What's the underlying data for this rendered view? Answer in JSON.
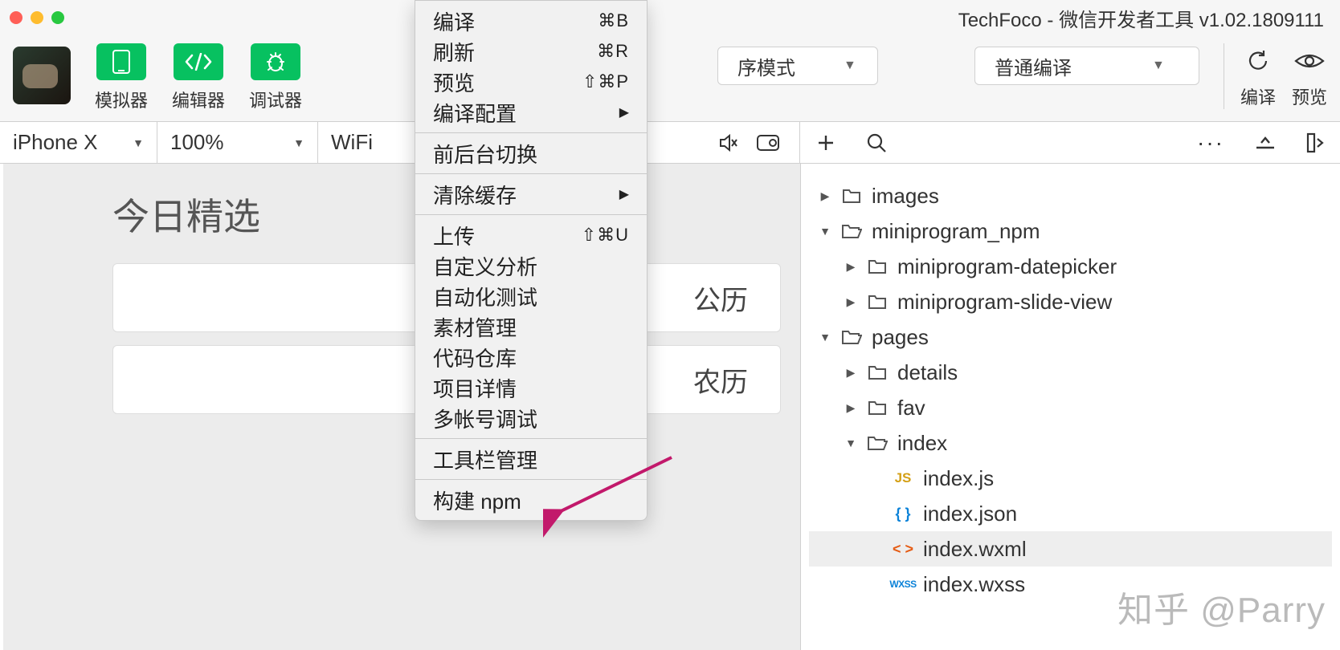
{
  "window": {
    "title": "TechFoco - 微信开发者工具 v1.02.1809111"
  },
  "toolbar": {
    "simulator": "模拟器",
    "editor": "编辑器",
    "debugger": "调试器",
    "mode_suffix": "序模式",
    "compile_mode": "普通编译",
    "compile": "编译",
    "preview": "预览"
  },
  "subbar": {
    "device": "iPhone X",
    "zoom": "100%",
    "network": "WiFi"
  },
  "simulator": {
    "heading": "今日精选",
    "row1": "公历",
    "row2": "农历"
  },
  "menu": {
    "items": [
      {
        "label": "编译",
        "shortcut": "⌘B",
        "type": "item"
      },
      {
        "label": "刷新",
        "shortcut": "⌘R",
        "type": "item"
      },
      {
        "label": "预览",
        "shortcut": "⇧⌘P",
        "type": "item"
      },
      {
        "label": "编译配置",
        "shortcut": "",
        "type": "submenu"
      },
      {
        "type": "sep"
      },
      {
        "label": "前后台切换",
        "shortcut": "",
        "type": "item"
      },
      {
        "type": "sep"
      },
      {
        "label": "清除缓存",
        "shortcut": "",
        "type": "submenu"
      },
      {
        "type": "sep"
      },
      {
        "label": "上传",
        "shortcut": "⇧⌘U",
        "type": "item"
      },
      {
        "label": "自定义分析",
        "shortcut": "",
        "type": "item"
      },
      {
        "label": "自动化测试",
        "shortcut": "",
        "type": "item"
      },
      {
        "label": "素材管理",
        "shortcut": "",
        "type": "item"
      },
      {
        "label": "代码仓库",
        "shortcut": "",
        "type": "item"
      },
      {
        "label": "项目详情",
        "shortcut": "",
        "type": "item"
      },
      {
        "label": "多帐号调试",
        "shortcut": "",
        "type": "item"
      },
      {
        "type": "sep"
      },
      {
        "label": "工具栏管理",
        "shortcut": "",
        "type": "item"
      },
      {
        "type": "sep"
      },
      {
        "label": "构建 npm",
        "shortcut": "",
        "type": "item"
      }
    ]
  },
  "tree": [
    {
      "indent": 0,
      "twisty": "▶",
      "icon": "folder",
      "label": "images"
    },
    {
      "indent": 0,
      "twisty": "▼",
      "icon": "folder-open",
      "label": "miniprogram_npm"
    },
    {
      "indent": 1,
      "twisty": "▶",
      "icon": "folder",
      "label": "miniprogram-datepicker"
    },
    {
      "indent": 1,
      "twisty": "▶",
      "icon": "folder",
      "label": "miniprogram-slide-view"
    },
    {
      "indent": 0,
      "twisty": "▼",
      "icon": "folder-open",
      "label": "pages"
    },
    {
      "indent": 1,
      "twisty": "▶",
      "icon": "folder",
      "label": "details"
    },
    {
      "indent": 1,
      "twisty": "▶",
      "icon": "folder",
      "label": "fav"
    },
    {
      "indent": 1,
      "twisty": "▼",
      "icon": "folder-open",
      "label": "index"
    },
    {
      "indent": 2,
      "twisty": "",
      "icon": "js",
      "label": "index.js"
    },
    {
      "indent": 2,
      "twisty": "",
      "icon": "json",
      "label": "index.json"
    },
    {
      "indent": 2,
      "twisty": "",
      "icon": "wxml",
      "label": "index.wxml",
      "selected": true
    },
    {
      "indent": 2,
      "twisty": "",
      "icon": "wxss",
      "label": "index.wxss"
    }
  ],
  "watermark": "知乎 @Parry"
}
